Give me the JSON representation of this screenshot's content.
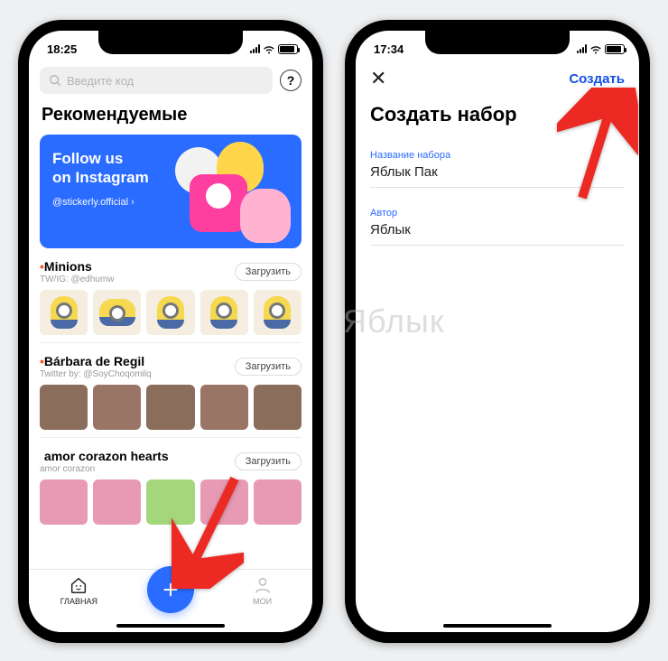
{
  "left": {
    "status_time": "18:25",
    "search_placeholder": "Введите код",
    "section_title": "Рекомендуемые",
    "banner": {
      "line": "Follow us\non Instagram",
      "handle": "@stickerly.official ›"
    },
    "packs": [
      {
        "name": "Minions",
        "sub": "TW/IG: @edhumw",
        "download": "Загрузить"
      },
      {
        "name": "Bárbara de Regil",
        "sub": "Twitter by: @SoyChoqomilq",
        "download": "Загрузить"
      },
      {
        "name": "amor corazon hearts",
        "sub": "amor corazon",
        "download": "Загрузить"
      }
    ],
    "tabs": {
      "home": "ГЛАВНАЯ",
      "my": "МОИ"
    }
  },
  "right": {
    "status_time": "17:34",
    "create_action": "Создать",
    "title": "Создать набор",
    "fields": [
      {
        "label": "Название набора",
        "value": "Яблык Пак"
      },
      {
        "label": "Автор",
        "value": "Яблык"
      }
    ]
  },
  "watermark": "Яблык"
}
